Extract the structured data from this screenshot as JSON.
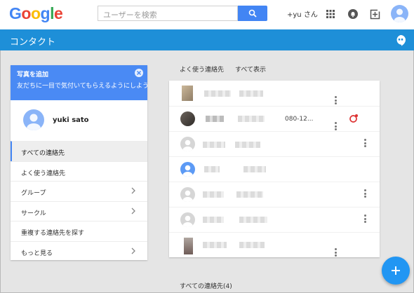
{
  "google_bar": {
    "logo_letters": [
      {
        "ch": "G",
        "color": "#4285f4"
      },
      {
        "ch": "o",
        "color": "#ea4335"
      },
      {
        "ch": "o",
        "color": "#fbbc05"
      },
      {
        "ch": "g",
        "color": "#4285f4"
      },
      {
        "ch": "l",
        "color": "#34a853"
      },
      {
        "ch": "e",
        "color": "#ea4335"
      }
    ],
    "search_placeholder": "ユーザーを検索",
    "search_icon": "search-icon",
    "user_name": "+yu   さん",
    "icons": [
      "apps-icon",
      "notifications-icon",
      "share-plus-icon",
      "account-avatar-icon"
    ]
  },
  "header": {
    "title": "コンタクト",
    "hangouts_icon": "hangouts-icon",
    "color": "#1e8fd8"
  },
  "sidebar": {
    "banner": {
      "title": "写真を追加",
      "description": "友だちに一目で気付いてもらえるようにしよう",
      "close_icon": "close-icon",
      "color": "#4a8af4"
    },
    "profile": {
      "name": "yuki sato"
    },
    "nav_items": [
      {
        "label": "すべての連絡先",
        "active": true,
        "chevron": false
      },
      {
        "label": "よく使う連絡先",
        "active": false,
        "chevron": false
      },
      {
        "label": "グループ",
        "active": false,
        "chevron": true
      },
      {
        "label": "サークル",
        "active": false,
        "chevron": true
      },
      {
        "label": "重複する連絡先を探す",
        "active": false,
        "chevron": false
      },
      {
        "label": "もっと見る",
        "active": false,
        "chevron": true
      }
    ]
  },
  "main": {
    "frequent_label": "よく使う連絡先",
    "show_all_label": "すべて表示",
    "contacts": [
      {
        "avatar": "photo1",
        "phone": "",
        "menu": "low"
      },
      {
        "avatar": "photo2",
        "phone": "080-12...",
        "menu": "low",
        "extra_icon": "birthday-reminder-icon"
      },
      {
        "avatar": "gray",
        "phone": "",
        "menu": "right"
      },
      {
        "avatar": "blue",
        "phone": "",
        "menu": "none"
      },
      {
        "avatar": "gray",
        "phone": "",
        "menu": "right"
      },
      {
        "avatar": "gray",
        "phone": "",
        "menu": "right"
      },
      {
        "avatar": "photo3",
        "phone": "",
        "menu": "low"
      }
    ],
    "all_contacts_label": "すべての連絡先(4)",
    "fab_icon": "add-icon",
    "accent_color": "#2196f3"
  }
}
